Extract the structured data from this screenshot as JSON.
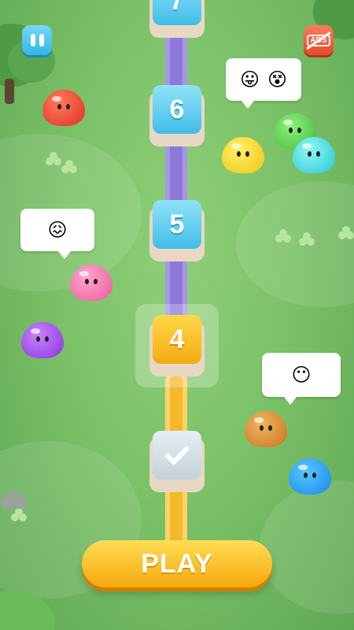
{
  "hud": {
    "pause_icon": "pause-icon",
    "remove_ads_label": "ADS"
  },
  "levels": [
    {
      "label": "7",
      "state": "locked"
    },
    {
      "label": "6",
      "state": "locked"
    },
    {
      "label": "5",
      "state": "locked"
    },
    {
      "label": "4",
      "state": "current"
    },
    {
      "label": "",
      "state": "completed",
      "icon": "checkmark-icon"
    }
  ],
  "bubbles": [
    {
      "emojis": [
        "😛",
        "😵"
      ]
    },
    {
      "emojis": [
        "😖"
      ]
    },
    {
      "emojis": [
        "😶"
      ]
    }
  ],
  "play_button": {
    "label": "PLAY"
  },
  "colors": {
    "background": "#7cc268",
    "track_locked": "#8d7ad8",
    "track_done": "#f3b92a",
    "tile_blue": "#42bde8",
    "tile_current": "#f5aa10",
    "play_button": "#f6a80c"
  }
}
